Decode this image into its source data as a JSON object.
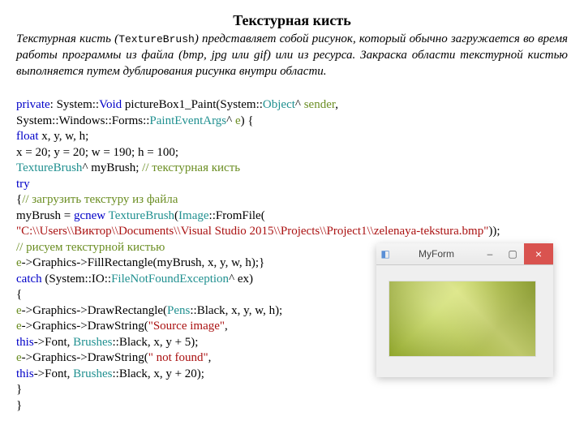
{
  "title": "Текстурная кисть",
  "desc_parts": {
    "p1": "Текстурная кисть (",
    "mono": "TextureBrush",
    "p2": ") представляет собой рисунок, который обычно загружается во время работы программы из файла (bmp, jpg или gif) или из ресурса. Закраска области текстурной кистью выполняется путем дублирования рисунка внутри области."
  },
  "code": {
    "l01a": "private",
    "l01b": ": System::",
    "l01c": "Void",
    "l01d": " pictureBox1_Paint(System::",
    "l01e": "Object",
    "l01f": "^ ",
    "l01g": "sender",
    "l01h": ",",
    "l02a": "System::Windows::Forms::",
    "l02b": "PaintEventArgs",
    "l02c": "^ ",
    "l02d": "e",
    "l02e": ") {",
    "l03a": "float",
    "l03b": " x, y, w, h;",
    "l04": "x = 20; y = 20; w = 190; h = 100;",
    "l05a": "TextureBrush",
    "l05b": "^ myBrush; ",
    "l05c": "// текстурная кисть",
    "l06": "try",
    "l07a": "{",
    "l07b": "// загрузить текстуру из файла",
    "l08a": "myBrush = ",
    "l08b": "gcnew",
    "l08c": " ",
    "l08d": "TextureBrush",
    "l08e": "(",
    "l08f": "Image",
    "l08g": "::FromFile(",
    "l09a": "\"C:\\\\Users\\\\Виктор\\\\Documents\\\\Visual Studio 2015\\\\Projects\\\\Project1\\\\zelenaya-tekstura.bmp\"",
    "l09b": "));",
    "l10": "// рисуем текстурной кистью",
    "l11a": "e",
    "l11b": "->Graphics->FillRectangle(myBrush, x, y, w, h);}",
    "l12a": "catch",
    "l12b": " (System::IO::",
    "l12c": "FileNotFoundException",
    "l12d": "^ ex)",
    "l13": "{",
    "l14a": "e",
    "l14b": "->Graphics->DrawRectangle(",
    "l14c": "Pens",
    "l14d": "::Black, x, y, w, h);",
    "l15a": "e",
    "l15b": "->Graphics->DrawString(",
    "l15c": "\"Source image\"",
    "l15d": ",",
    "l16a": "this",
    "l16b": "->Font, ",
    "l16c": "Brushes",
    "l16d": "::Black, x, y + 5);",
    "l17a": "e",
    "l17b": "->Graphics->DrawString(",
    "l17c": "\" not found\"",
    "l17d": ",",
    "l18a": "this",
    "l18b": "->Font, ",
    "l18c": "Brushes",
    "l18d": "::Black, x, y + 20);",
    "l19": "}",
    "l20": "}"
  },
  "window": {
    "title": "MyForm",
    "min": "–",
    "max": "▢",
    "close": "×"
  }
}
